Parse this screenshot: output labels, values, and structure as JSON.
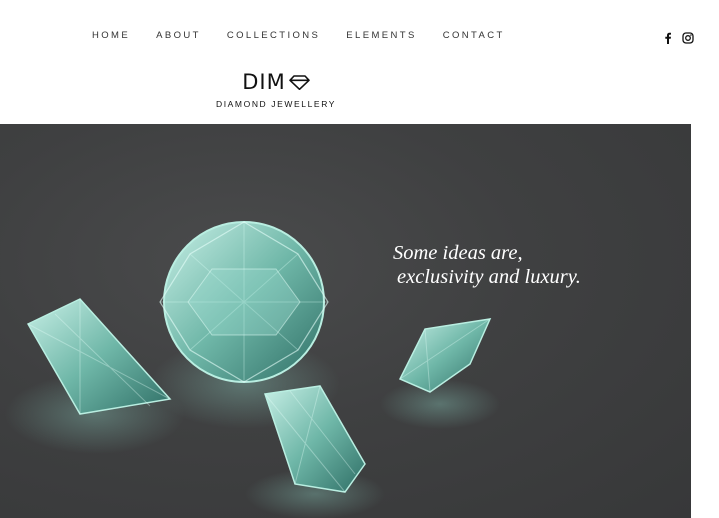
{
  "nav": {
    "items": [
      "HOME",
      "ABOUT",
      "COLLECTIONS",
      "ELEMENTS",
      "CONTACT"
    ]
  },
  "social": {
    "icons": [
      "facebook-icon",
      "instagram-icon"
    ]
  },
  "logo": {
    "mark": "DIM",
    "icon": "diamond-outline-icon",
    "subtitle": "DIAMOND JEWELLERY"
  },
  "hero": {
    "tagline_line1": "Some ideas are,",
    "tagline_line2": "exclusivity and luxury."
  },
  "colors": {
    "hero_background": "#3f4041",
    "diamond": "#8fd3c4",
    "text_dark": "#333333",
    "tagline": "#ffffff"
  }
}
